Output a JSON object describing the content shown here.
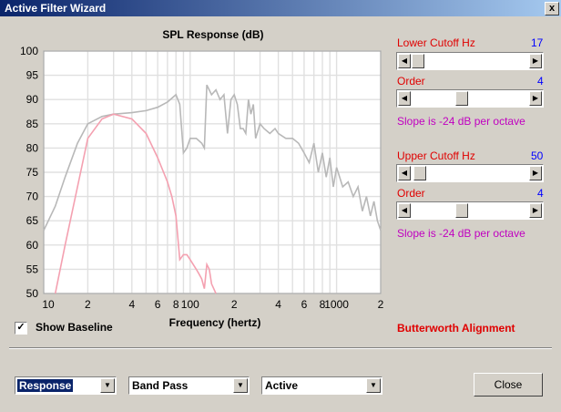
{
  "window": {
    "title": "Active Filter Wizard",
    "close_glyph": "x"
  },
  "chart_data": {
    "type": "line",
    "title": "SPL Response (dB)",
    "xlabel": "Frequency (hertz)",
    "ylabel": "",
    "xscale": "log",
    "xlim": [
      10,
      2000
    ],
    "ylim": [
      50,
      100
    ],
    "grid": true,
    "y_ticks": [
      "100",
      "95",
      "90",
      "85",
      "80",
      "75",
      "70",
      "65",
      "60",
      "55",
      "50"
    ],
    "x_ticks": [
      {
        "v": 10,
        "label": "10"
      },
      {
        "v": 20,
        "label": "2"
      },
      {
        "v": 40,
        "label": "4"
      },
      {
        "v": 60,
        "label": "6"
      },
      {
        "v": 80,
        "label": "8"
      },
      {
        "v": 100,
        "label": "100"
      },
      {
        "v": 200,
        "label": "2"
      },
      {
        "v": 400,
        "label": "4"
      },
      {
        "v": 600,
        "label": "6"
      },
      {
        "v": 800,
        "label": "8"
      },
      {
        "v": 1000,
        "label": "1000"
      },
      {
        "v": 2000,
        "label": "2"
      }
    ],
    "series": [
      {
        "color": "#b8b8b8",
        "x": [
          10,
          12,
          14,
          17,
          20,
          25,
          30,
          40,
          50,
          60,
          70,
          80,
          85,
          90,
          95,
          100,
          110,
          120,
          125,
          130,
          140,
          150,
          160,
          170,
          180,
          190,
          200,
          210,
          220,
          230,
          240,
          250,
          260,
          270,
          280,
          300,
          320,
          350,
          380,
          400,
          450,
          500,
          550,
          600,
          650,
          700,
          750,
          800,
          850,
          900,
          950,
          1000,
          1100,
          1200,
          1300,
          1400,
          1500,
          1600,
          1700,
          1800,
          1900,
          2000
        ],
        "y": [
          63,
          68,
          74,
          81,
          85,
          86.5,
          87,
          87.3,
          87.7,
          88.4,
          89.5,
          91,
          89,
          79,
          80,
          82,
          82,
          81,
          80,
          93,
          91,
          92,
          90,
          91,
          83,
          90,
          91,
          89,
          84,
          84,
          83,
          90,
          87,
          89,
          82,
          85,
          84,
          83,
          84,
          83,
          82,
          82,
          81,
          79,
          77,
          81,
          75,
          79,
          74,
          78,
          72,
          76,
          72,
          73,
          70,
          72,
          67,
          70,
          66,
          69,
          65,
          63
        ]
      },
      {
        "color": "#f4a0b0",
        "x": [
          12,
          14,
          17,
          20,
          25,
          30,
          40,
          50,
          60,
          70,
          75,
          80,
          85,
          90,
          95,
          100,
          110,
          115,
          120,
          125,
          130,
          135,
          140,
          145,
          150
        ],
        "y": [
          50,
          60,
          72,
          82,
          86,
          87,
          86,
          83,
          78,
          73,
          70,
          66,
          57,
          58,
          58,
          57,
          55,
          54,
          53,
          51,
          56,
          55,
          52,
          51,
          50
        ]
      }
    ]
  },
  "panel": {
    "lower_cutoff_label": "Lower Cutoff  Hz",
    "lower_cutoff_value": "17",
    "lower_cutoff_level": 0.0,
    "lower_order_label": "Order",
    "lower_order_value": "4",
    "lower_order_level": 0.42,
    "lower_slope_text": "Slope is -24 dB per octave",
    "upper_cutoff_label": "Upper Cutoff  Hz",
    "upper_cutoff_value": "50",
    "upper_cutoff_level": 0.02,
    "upper_order_label": "Order",
    "upper_order_value": "4",
    "upper_order_level": 0.42,
    "upper_slope_text": "Slope is -24 dB per octave",
    "alignment_text": "Butterworth Alignment"
  },
  "baseline": {
    "label": "Show Baseline",
    "checked_glyph": "✓"
  },
  "bottom": {
    "view_combo": "Response",
    "filter_combo": "Band Pass",
    "type_combo": "Active",
    "close_label": "Close"
  },
  "colors": {
    "accent_red": "#e00000",
    "value_blue": "#0000ff",
    "slope_magenta": "#c000c0"
  }
}
